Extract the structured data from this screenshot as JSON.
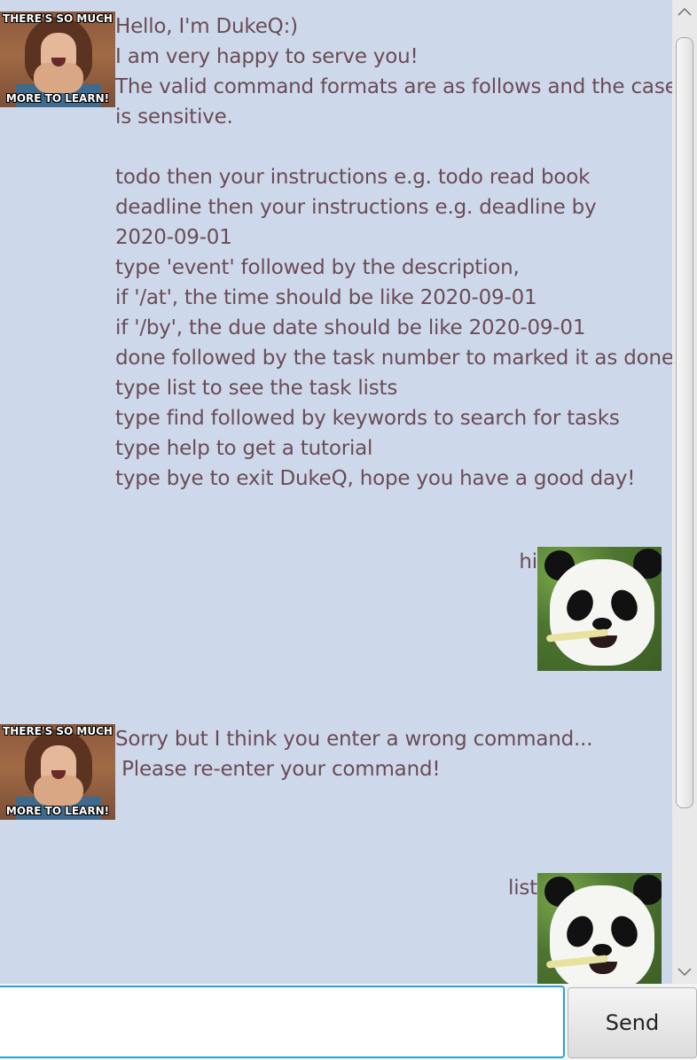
{
  "messages": {
    "bot_welcome": [
      "Hello, I'm DukeQ:)",
      "I am very happy to serve you!",
      "The valid command formats are as follows and the case",
      "is sensitive.",
      "",
      "todo then your instructions e.g. todo read book",
      "deadline then your instructions e.g. deadline by",
      "2020-09-01",
      "type 'event' followed by the description,",
      "if '/at', the time should be like 2020-09-01",
      "if '/by', the due date should be like 2020-09-01",
      "done followed by the task number to marked it as done",
      "type list to see the task lists",
      "type find followed by keywords to search for tasks",
      "type help to get a tutorial",
      "type bye to exit DukeQ, hope you have a good day!"
    ],
    "user_hi": "hi",
    "bot_error": [
      "Sorry but I think you enter a wrong command...",
      " Please re-enter your command!"
    ],
    "user_list": "list"
  },
  "bot_avatar": {
    "caption_top": "THERE'S SO MUCH",
    "caption_bottom": "MORE TO LEARN!"
  },
  "scrollbar": {
    "up_icon": "chevron-up-icon",
    "down_icon": "chevron-down-icon"
  },
  "input": {
    "value": "",
    "placeholder": ""
  },
  "send_label": "Send",
  "colors": {
    "chat_background": "#cdd9ea",
    "text": "#6b4b57",
    "input_focus_border": "#2aa2d6"
  }
}
